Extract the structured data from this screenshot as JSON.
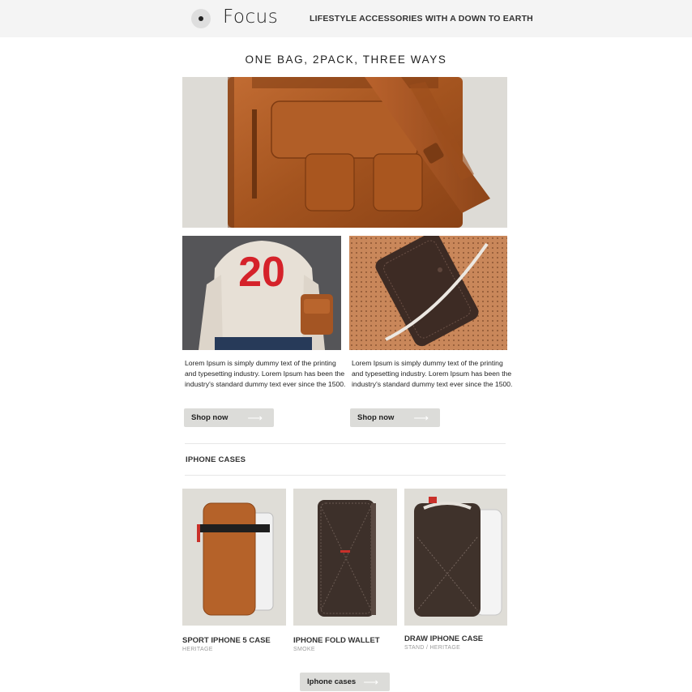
{
  "header": {
    "logo_text": "Focus",
    "tagline": "LIFESTYLE ACCESSORIES WITH A DOWN TO EARTH"
  },
  "hero": {
    "headline": "ONE BAG, 2PACK, THREE WAYS",
    "image_icon": "leather-messenger-bag"
  },
  "features": [
    {
      "image_icon": "person-sweater-20-with-bag",
      "sweater_number": "20",
      "description": "Lorem Ipsum is simply dummy text of the printing and typesetting industry. Lorem Ipsum has been the industry's standard dummy text ever since the 1500.",
      "button_label": "Shop now"
    },
    {
      "image_icon": "leather-phone-sleeve",
      "description": "Lorem Ipsum is simply dummy text of the printing and typesetting industry. Lorem Ipsum has been the industry's standard dummy text ever since the 1500.",
      "button_label": "Shop now"
    }
  ],
  "iphone_section": {
    "title": "IPHONE CASES",
    "products": [
      {
        "name": "SPORT IPHONE 5 CASE",
        "subtitle": "HERITAGE",
        "image_icon": "tan-leather-case"
      },
      {
        "name": "IPHONE FOLD WALLET",
        "subtitle": "SMOKE",
        "image_icon": "dark-leather-wallet"
      },
      {
        "name": "DRAW IPHONE CASE",
        "subtitle": "STAND / HERITAGE",
        "image_icon": "dark-leather-sleeve"
      }
    ],
    "button_label": "Iphone cases"
  },
  "colors": {
    "header_bg": "#f4f4f4",
    "button_bg": "#dcdcd9",
    "leather_tan": "#b3602a",
    "leather_dark": "#3e302a"
  }
}
